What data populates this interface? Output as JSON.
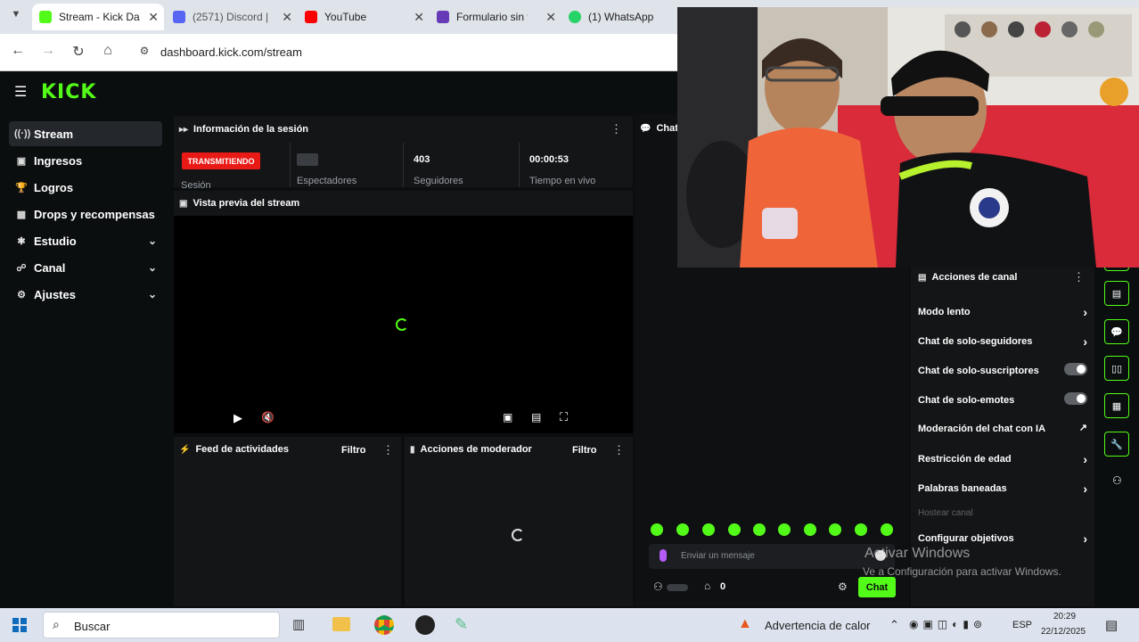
{
  "browser": {
    "tabs": [
      {
        "title": "Stream - Kick Da",
        "color": "#53fc18"
      },
      {
        "title": "(2571) Discord |",
        "color": "#5865f2"
      },
      {
        "title": "YouTube",
        "color": "#ff0000"
      },
      {
        "title": "Formulario sin t",
        "color": "#673ab7"
      },
      {
        "title": "(1) WhatsApp",
        "color": "#25d366"
      }
    ],
    "url": "dashboard.kick.com/stream"
  },
  "kick": {
    "logo": "KICK",
    "sidebar": [
      {
        "label": "Stream",
        "icon": "stream-icon"
      },
      {
        "label": "Ingresos",
        "icon": "revenue-icon"
      },
      {
        "label": "Logros",
        "icon": "trophy-icon"
      },
      {
        "label": "Drops y recompensas",
        "icon": "gift-icon"
      },
      {
        "label": "Estudio",
        "icon": "studio-icon"
      },
      {
        "label": "Canal",
        "icon": "channel-icon"
      },
      {
        "label": "Ajustes",
        "icon": "gear-icon"
      }
    ],
    "session": {
      "title": "Información de la sesión",
      "badge": "TRANSMITIENDO",
      "session_label": "Sesión",
      "stats": [
        {
          "value": "",
          "label": "Espectadores"
        },
        {
          "value": "403",
          "label": "Seguidores"
        },
        {
          "value": "00:00:53",
          "label": "Tiempo en vivo"
        }
      ]
    },
    "preview_title": "Vista previa del stream",
    "feed": {
      "title": "Feed de actividades",
      "filter": "Filtro"
    },
    "mod_actions": {
      "title": "Acciones de moderador",
      "filter": "Filtro"
    },
    "chat": {
      "title": "Chat",
      "placeholder": "Enviar un mensaje",
      "count": "0",
      "send_label": "Chat"
    },
    "channel_actions": {
      "title": "Acciones de canal",
      "items": [
        {
          "label": "Modo lento"
        },
        {
          "label": "Chat de solo-seguidores"
        },
        {
          "label": "Chat de solo-suscriptores"
        },
        {
          "label": "Chat de solo-emotes"
        },
        {
          "label": "Moderación del chat con IA"
        },
        {
          "label": "Restricción de edad"
        },
        {
          "label": "Palabras baneadas"
        },
        {
          "label": "Hostear canal"
        },
        {
          "label": "Configurar objetivos"
        }
      ]
    }
  },
  "watermark": {
    "line1": "Activar Windows",
    "line2": "Ve a Configuración para activar Windows."
  },
  "taskbar": {
    "search": "Buscar",
    "weather": "Advertencia de calor",
    "lang": "ESP",
    "time": "20:29",
    "date": "22/12/2025"
  }
}
